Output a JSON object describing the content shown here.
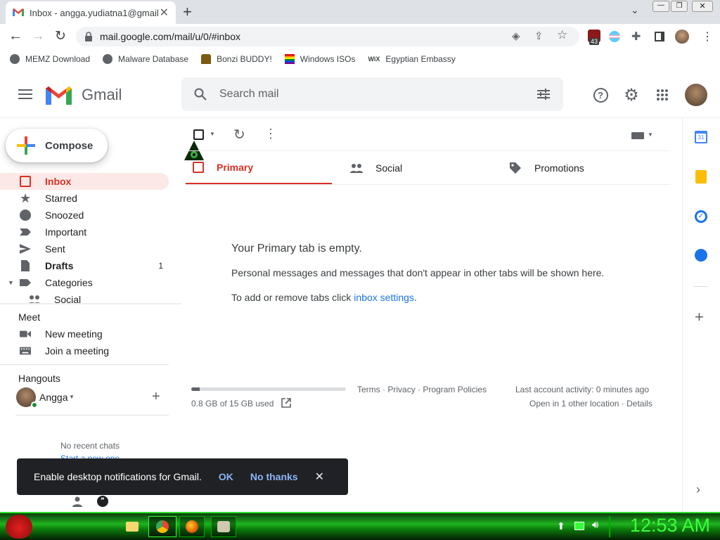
{
  "browser": {
    "tab_title": "Inbox - angga.yudiatna1@gmail.",
    "url": "mail.google.com/mail/u/0/#inbox",
    "extension_badge": "43",
    "bookmarks": [
      {
        "label": "MEMZ Download",
        "icon": "globe-icon"
      },
      {
        "label": "Malware Database",
        "icon": "globe-icon"
      },
      {
        "label": "Bonzi BUDDY!",
        "icon": "bonzi-icon"
      },
      {
        "label": "Windows ISOs",
        "icon": "windows-icon"
      },
      {
        "label": "Egyptian Embassy",
        "icon": "wix-icon"
      }
    ]
  },
  "gmail": {
    "logo_text": "Gmail",
    "search_placeholder": "Search mail",
    "compose_label": "Compose",
    "nav": [
      {
        "label": "Inbox",
        "count": "",
        "active": true
      },
      {
        "label": "Starred",
        "count": ""
      },
      {
        "label": "Snoozed",
        "count": ""
      },
      {
        "label": "Important",
        "count": ""
      },
      {
        "label": "Sent",
        "count": ""
      },
      {
        "label": "Drafts",
        "count": "1"
      },
      {
        "label": "Categories",
        "count": ""
      },
      {
        "label": "Social",
        "count": ""
      }
    ],
    "meet": {
      "heading": "Meet",
      "new_meeting": "New meeting",
      "join_meeting": "Join a meeting"
    },
    "hangouts": {
      "heading": "Hangouts",
      "user": "Angga",
      "no_chats": "No recent chats",
      "start_new": "Start a new one"
    },
    "tabs": [
      {
        "label": "Primary"
      },
      {
        "label": "Social"
      },
      {
        "label": "Promotions"
      }
    ],
    "empty": {
      "title": "Your Primary tab is empty.",
      "desc": "Personal messages and messages that don't appear in other tabs will be shown here.",
      "settings_prefix": "To add or remove tabs click ",
      "settings_link": "inbox settings",
      "settings_suffix": "."
    },
    "footer": {
      "storage": "0.8 GB of 15 GB used",
      "storage_fraction": 0.053,
      "terms": "Terms",
      "privacy": "Privacy",
      "policies": "Program Policies",
      "sep": "·",
      "last_activity": "Last account activity: 0 minutes ago",
      "open_location": "Open in 1 other location",
      "details": "Details"
    },
    "snackbar": {
      "message": "Enable desktop notifications for Gmail.",
      "ok": "OK",
      "no_thanks": "No thanks"
    }
  },
  "taskbar": {
    "clock": "12:53 AM"
  },
  "colors": {
    "accent_red": "#d93025",
    "link_blue": "#1a73e8",
    "snack_action": "#8ab4f8"
  }
}
